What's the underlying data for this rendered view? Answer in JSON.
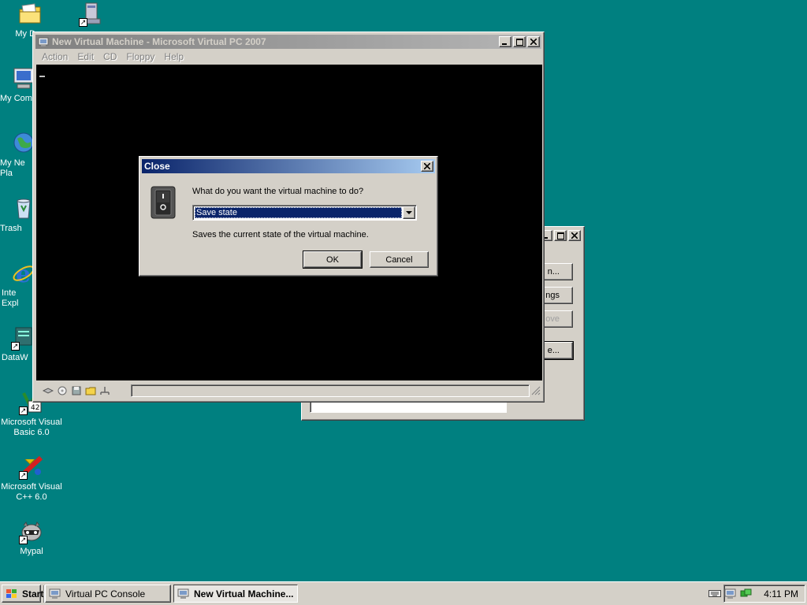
{
  "desktop": {
    "icons": [
      {
        "label": "My Doc",
        "icon": "my-documents-icon"
      },
      {
        "label": "",
        "icon": "network-computer-shortcut-icon"
      },
      {
        "label": "My Com",
        "icon": "my-computer-icon"
      },
      {
        "label": "My Ne\nPla",
        "icon": "my-network-places-icon"
      },
      {
        "label": "Trash",
        "icon": "recycle-bin-icon"
      },
      {
        "label": "Inte\nExpl",
        "icon": "internet-explorer-icon"
      },
      {
        "label": "DataW",
        "icon": "datawindow-icon"
      },
      {
        "label": "Microsoft Visual\nBasic 6.0",
        "icon": "visual-basic-icon"
      },
      {
        "label": "Microsoft Visual\nC++ 6.0",
        "icon": "visual-cpp-icon"
      },
      {
        "label": "Mypal",
        "icon": "mypal-raccoon-icon"
      }
    ]
  },
  "console_window": {
    "buttons": [
      "n...",
      "ngs",
      "ove",
      "e..."
    ]
  },
  "vm_window": {
    "title": "New Virtual Machine - Microsoft Virtual PC 2007",
    "menu": [
      "Action",
      "Edit",
      "CD",
      "Floppy",
      "Help"
    ]
  },
  "dialog": {
    "title": "Close",
    "question": "What do you want the virtual machine to do?",
    "selected_option": "Save state",
    "description": "Saves the current state of the virtual machine.",
    "ok_label": "OK",
    "cancel_label": "Cancel"
  },
  "taskbar": {
    "start_label": "Start",
    "tasks": [
      {
        "label": "Virtual PC Console",
        "active": false
      },
      {
        "label": "New Virtual Machine...",
        "active": true
      }
    ],
    "clock": "4:11 PM"
  },
  "colors": {
    "desktop": "#008080",
    "active_title_start": "#0a246a",
    "active_title_end": "#a6caf0",
    "face": "#d4d0c8"
  }
}
